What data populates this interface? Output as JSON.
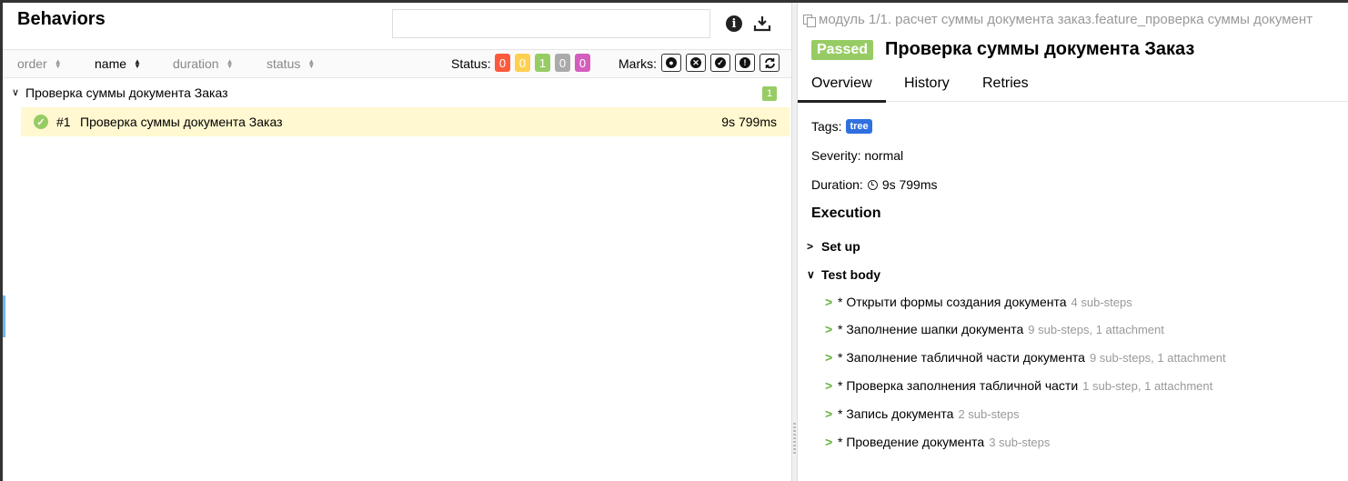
{
  "left": {
    "title": "Behaviors",
    "search_placeholder": "",
    "sort": [
      {
        "label": "order",
        "active": false
      },
      {
        "label": "name",
        "active": true
      },
      {
        "label": "duration",
        "active": false
      },
      {
        "label": "status",
        "active": false
      }
    ],
    "status_label": "Status:",
    "status_badges": [
      {
        "value": "0",
        "color": "#fd5a3e"
      },
      {
        "value": "0",
        "color": "#ffd050"
      },
      {
        "value": "1",
        "color": "#97cc64"
      },
      {
        "value": "0",
        "color": "#aaaaaa"
      },
      {
        "value": "0",
        "color": "#d35ebe"
      }
    ],
    "marks_label": "Marks:",
    "marks": [
      "flaky-icon",
      "new-failed-icon",
      "new-passed-icon",
      "new-broken-icon",
      "retries-icon"
    ],
    "group": {
      "title": "Проверка суммы документа Заказ",
      "count": "1"
    },
    "test": {
      "num": "#1",
      "name": "Проверка суммы документа Заказ",
      "duration": "9s 799ms"
    }
  },
  "right": {
    "path": "модуль 1/1. расчет суммы документа заказ.feature_проверка суммы документ",
    "status": "Passed",
    "title": "Проверка суммы документа Заказ",
    "tabs": [
      "Overview",
      "History",
      "Retries"
    ],
    "tags_label": "Tags:",
    "tag": "tree",
    "severity": "Severity: normal",
    "duration_label": "Duration:",
    "duration": "9s 799ms",
    "execution": "Execution",
    "setup": "Set up",
    "test_body": "Test body",
    "steps": [
      {
        "name": "* Открыти формы создания документа",
        "meta": "4 sub-steps"
      },
      {
        "name": "* Заполнение шапки документа",
        "meta": "9 sub-steps, 1 attachment"
      },
      {
        "name": "* Заполнение табличной части документа",
        "meta": "9 sub-steps, 1 attachment"
      },
      {
        "name": "* Проверка заполнения табличной части",
        "meta": "1 sub-step, 1 attachment"
      },
      {
        "name": "* Запись документа",
        "meta": "2 sub-steps"
      },
      {
        "name": "* Проведение документа",
        "meta": "3 sub-steps"
      }
    ]
  }
}
